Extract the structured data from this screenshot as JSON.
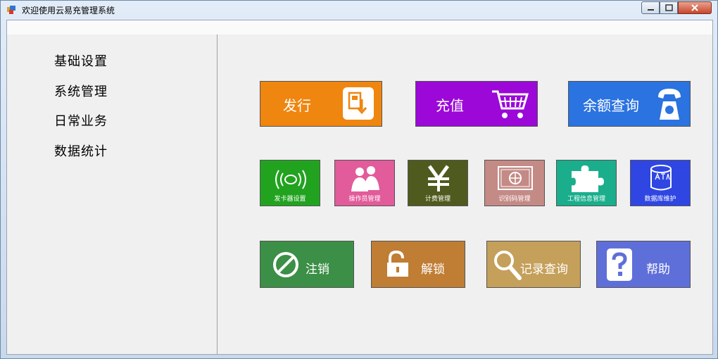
{
  "window": {
    "title": "欢迎使用云易充管理系统"
  },
  "nav": {
    "items": [
      {
        "label": "基础设置"
      },
      {
        "label": "系统管理"
      },
      {
        "label": "日常业务"
      },
      {
        "label": "数据统计"
      }
    ]
  },
  "tiles": {
    "big": [
      {
        "label": "发行",
        "color": "#ef8610",
        "icon": "card-issue-icon"
      },
      {
        "label": "充值",
        "color": "#9b08d8",
        "icon": "shopping-cart-icon"
      },
      {
        "label": "余额查询",
        "color": "#2a73e0",
        "icon": "telephone-icon"
      }
    ],
    "small": [
      {
        "label": "发卡器设置",
        "color": "#22a320",
        "icon": "card-reader-icon"
      },
      {
        "label": "操作员管理",
        "color": "#e25b9a",
        "icon": "operators-icon"
      },
      {
        "label": "计费管理",
        "color": "#4f5a1e",
        "icon": "yen-icon"
      },
      {
        "label": "识别码管理",
        "color": "#c48a86",
        "icon": "id-code-icon"
      },
      {
        "label": "工程信息管理",
        "color": "#1aae8c",
        "icon": "puzzle-icon"
      },
      {
        "label": "数据库维护",
        "color": "#2f46e3",
        "icon": "database-icon"
      }
    ],
    "bottom": [
      {
        "label": "注销",
        "color": "#3c8f46",
        "icon": "no-entry-icon"
      },
      {
        "label": "解锁",
        "color": "#c07d34",
        "icon": "unlock-icon"
      },
      {
        "label": "记录查询",
        "color": "#c5a05a",
        "icon": "search-icon"
      },
      {
        "label": "帮助",
        "color": "#5f6fd9",
        "icon": "help-icon"
      }
    ]
  }
}
